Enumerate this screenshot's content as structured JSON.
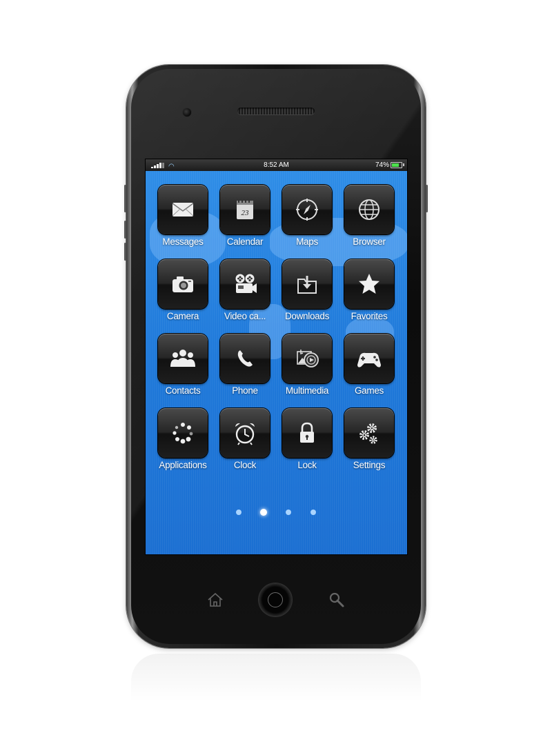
{
  "status_bar": {
    "time": "8:52 AM",
    "battery_percent": "74%",
    "battery_level": 0.74,
    "icons": [
      "signal-icon",
      "wifi-icon",
      "battery-icon"
    ]
  },
  "apps": [
    {
      "label": "Messages",
      "icon": "envelope-icon"
    },
    {
      "label": "Calendar",
      "icon": "calendar-icon",
      "icon_text": "23"
    },
    {
      "label": "Maps",
      "icon": "compass-icon"
    },
    {
      "label": "Browser",
      "icon": "globe-icon"
    },
    {
      "label": "Camera",
      "icon": "camera-icon"
    },
    {
      "label": "Video ca...",
      "icon": "video-camera-icon"
    },
    {
      "label": "Downloads",
      "icon": "download-icon"
    },
    {
      "label": "Favorites",
      "icon": "star-icon"
    },
    {
      "label": "Contacts",
      "icon": "contacts-icon"
    },
    {
      "label": "Phone",
      "icon": "phone-icon"
    },
    {
      "label": "Multimedia",
      "icon": "multimedia-icon"
    },
    {
      "label": "Games",
      "icon": "gamepad-icon"
    },
    {
      "label": "Applications",
      "icon": "apps-icon"
    },
    {
      "label": "Clock",
      "icon": "alarm-clock-icon"
    },
    {
      "label": "Lock",
      "icon": "lock-icon"
    },
    {
      "label": "Settings",
      "icon": "gears-icon"
    }
  ],
  "page_indicator": {
    "pages": 4,
    "current_page": 2
  },
  "hardware_buttons": [
    "home-key-icon",
    "home-button",
    "search-key-icon"
  ],
  "colors": {
    "screen_blue": "#1f79da",
    "battery_green": "#4de04d"
  }
}
